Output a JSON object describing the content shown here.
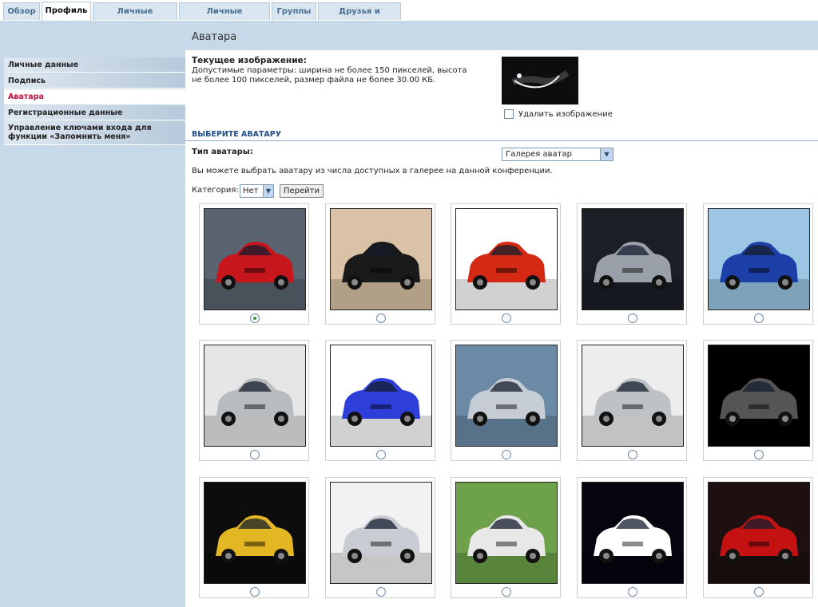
{
  "tabs": [
    {
      "label": "Обзор",
      "active": false
    },
    {
      "label": "Профиль",
      "active": true
    },
    {
      "label": "Личные настройки",
      "active": false
    },
    {
      "label": "Личные сообщения",
      "active": false
    },
    {
      "label": "Группы",
      "active": false
    },
    {
      "label": "Друзья и недруги",
      "active": false
    }
  ],
  "page_title": "Аватара",
  "sidebar": {
    "items": [
      {
        "label": "Личные данные",
        "active": false
      },
      {
        "label": "Подпись",
        "active": false
      },
      {
        "label": "Аватара",
        "active": true
      },
      {
        "label": "Регистрационные данные",
        "active": false
      },
      {
        "label": "Управление ключами входа для функции «Запомнить меня»",
        "active": false
      }
    ]
  },
  "current": {
    "label": "Текущее изображение:",
    "description": "Допустимые параметры: ширина не более 150 пикселей, высота не более 100 пикселей, размер файла не более 30.00 КБ.",
    "delete_label": "Удалить изображение"
  },
  "section_title": "ВЫБЕРИТЕ АВАТАРУ",
  "avatar_type": {
    "label": "Тип аватары:",
    "value": "Галерея аватар"
  },
  "info": "Вы можете выбрать аватару из числа доступных в галерее на данной конференции.",
  "category": {
    "label": "Категория:",
    "value": "Нет",
    "button": "Перейти"
  },
  "gallery": [
    {
      "bg": "#5a6470",
      "car": "#c8161d",
      "selected": true
    },
    {
      "bg": "#d9c2a6",
      "car": "#1a1a1a",
      "selected": false
    },
    {
      "bg": "#ffffff",
      "car": "#d42a14",
      "selected": false
    },
    {
      "bg": "#1c1e26",
      "car": "#9aa0aa",
      "selected": false
    },
    {
      "bg": "#9cc6e4",
      "car": "#1d3fa8",
      "selected": false
    },
    {
      "bg": "#e6e6e6",
      "car": "#b9bcbf",
      "selected": false
    },
    {
      "bg": "#ffffff",
      "car": "#2d3fd8",
      "selected": false
    },
    {
      "bg": "#6a8aa6",
      "car": "#c6ccd4",
      "selected": false
    },
    {
      "bg": "#ededed",
      "car": "#bfc2c4",
      "selected": false
    },
    {
      "bg": "#000000",
      "car": "#555555",
      "selected": false
    },
    {
      "bg": "#0d0d0d",
      "car": "#e3b623",
      "selected": false
    },
    {
      "bg": "#f2f2f2",
      "car": "#c9ccd2",
      "selected": false
    },
    {
      "bg": "#6da24a",
      "car": "#e8e8e8",
      "selected": false
    },
    {
      "bg": "#05050f",
      "car": "#ffffff",
      "selected": false
    },
    {
      "bg": "#1e1010",
      "car": "#c41212",
      "selected": false
    }
  ]
}
